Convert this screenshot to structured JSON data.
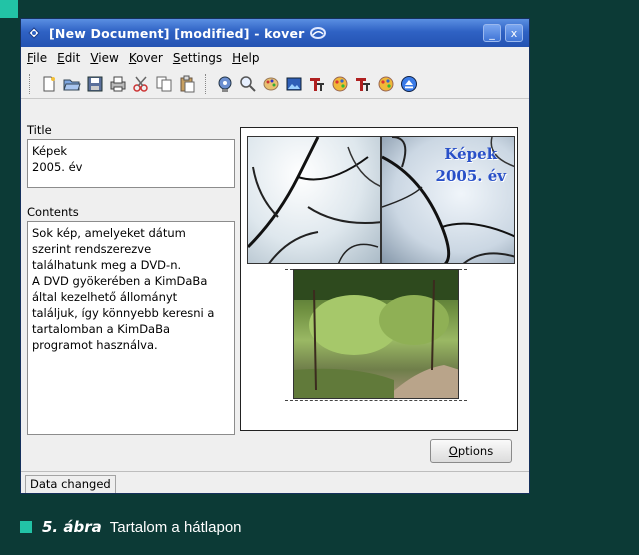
{
  "window": {
    "title": "[New Document] [modified] - kover",
    "minimize_glyph": "_",
    "close_glyph": "x"
  },
  "menu": [
    "File",
    "Edit",
    "View",
    "Kover",
    "Settings",
    "Help"
  ],
  "toolbar": {
    "icons": [
      "new-icon",
      "open-icon",
      "save-icon",
      "print-icon",
      "cut-icon",
      "copy-icon",
      "paste-icon",
      "cddb-icon",
      "preview-icon",
      "image-icon",
      "background-icon",
      "front-title-font-icon",
      "front-color-icon",
      "back-title-font-icon",
      "back-color-icon",
      "eject-icon"
    ]
  },
  "title_field": {
    "label": "Title",
    "lines": [
      "Képek",
      "2005. év"
    ]
  },
  "contents_field": {
    "label": "Contents",
    "lines": [
      "Sok kép, amelyeket dátum",
      "szerint rendszerezve",
      "találhatunk meg a DVD-n.",
      "A DVD gyökerében a KimDaBa",
      "által kezelhető állományt",
      "találjuk, így könnyebb keresni a",
      "tartalomban a KimDaBa",
      "programot használva."
    ]
  },
  "preview": {
    "front_title_line1": "Képek",
    "front_title_line2": "2005. év"
  },
  "options_button": "Options",
  "status": "Data changed",
  "caption": {
    "number": "5. ábra",
    "text": "Tartalom a hátlapon"
  },
  "colors": {
    "background": "#0c3a36",
    "accent": "#22c3a6",
    "titlebar": "#2f62c4"
  }
}
